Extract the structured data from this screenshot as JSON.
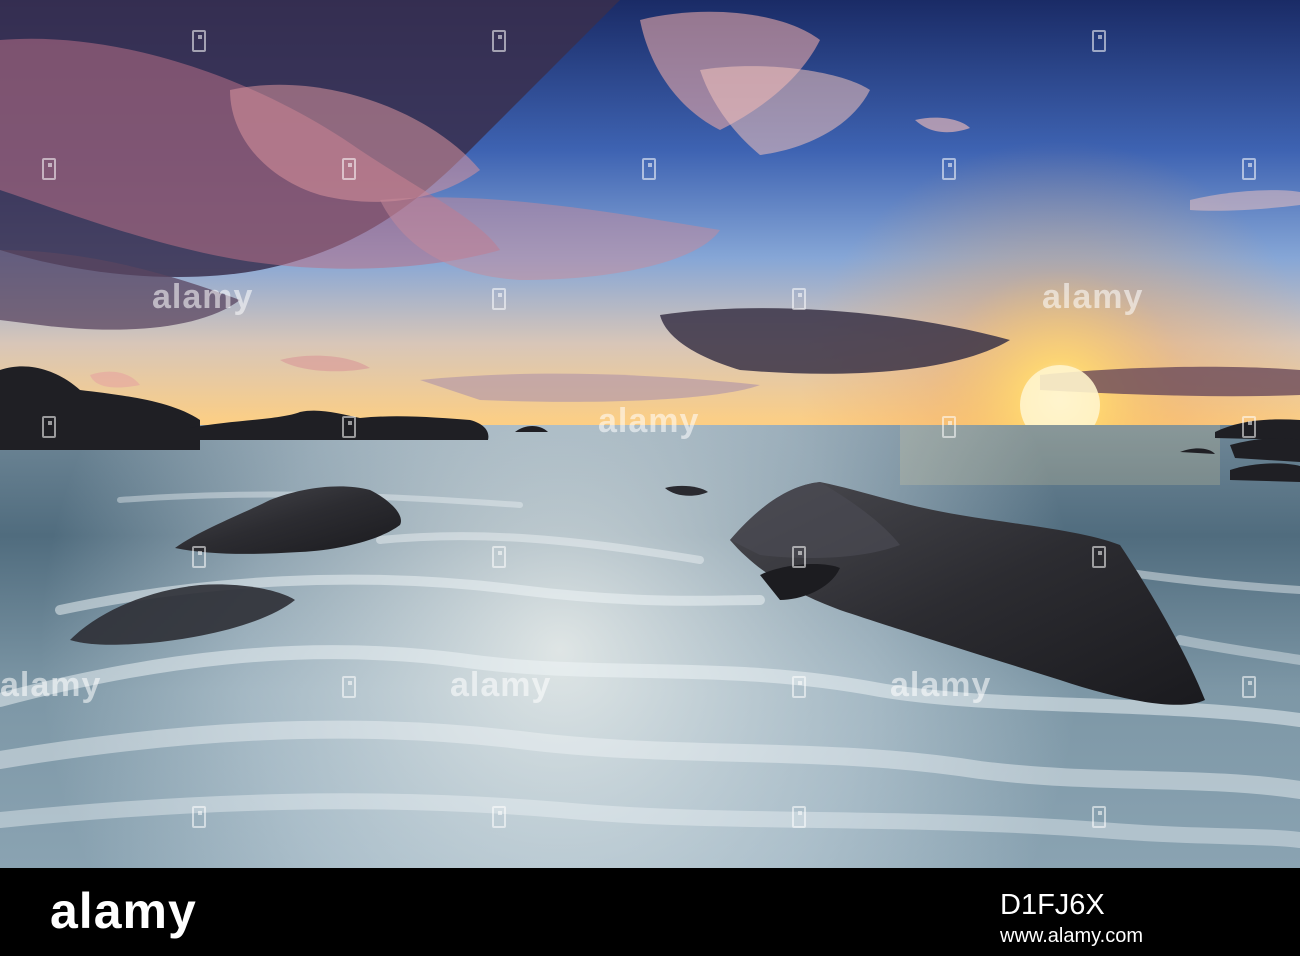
{
  "watermark": {
    "text": "alamy"
  },
  "footer": {
    "brand": "alamy",
    "image_id_label": "D1FJ6X",
    "site": "www.alamy.com"
  },
  "colors": {
    "sky_top": "#1e2f6b",
    "sky_mid": "#4a6fb8",
    "cloud_pink": "#d9909a",
    "cloud_dark": "#3a2f4a",
    "sun_glow": "#ffcf6a",
    "sea": "#6c8a9c",
    "foam": "#e8eef2",
    "rock": "#2a2a2e"
  }
}
